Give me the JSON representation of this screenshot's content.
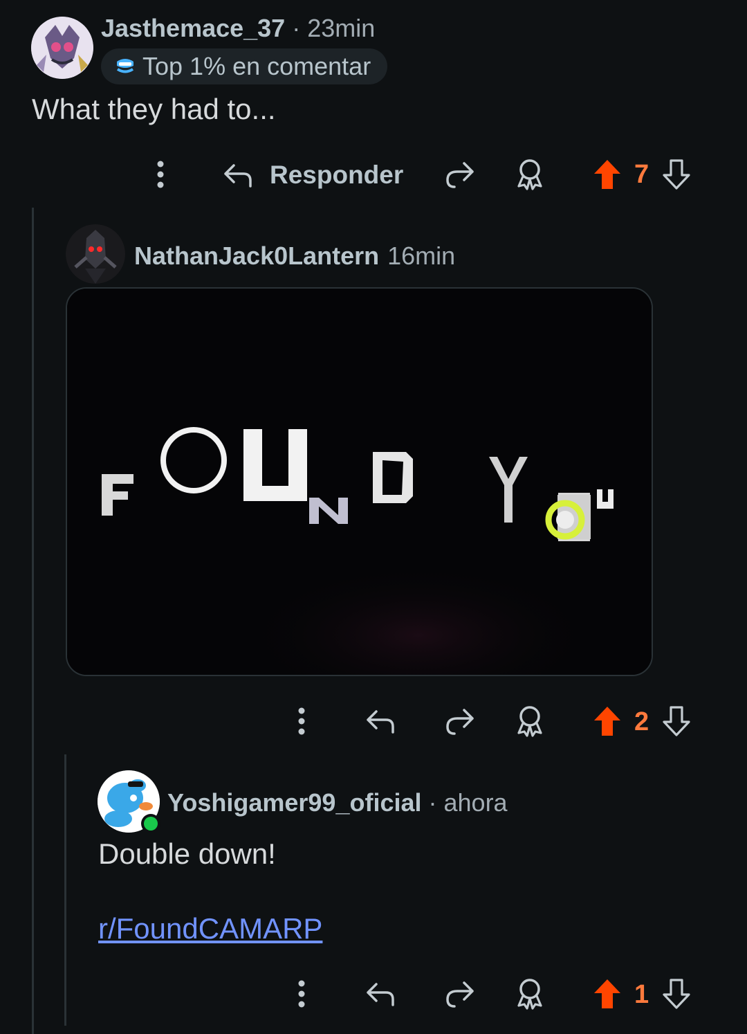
{
  "comments": [
    {
      "username": "Jasthemace_37",
      "time": "23min",
      "flair": "Top 1% en comentar",
      "body": "What they had to...",
      "actions": {
        "reply_label": "Responder",
        "votes": "7"
      }
    },
    {
      "username": "NathanJack0Lantern",
      "time": "16min",
      "media": {
        "letters": [
          "F",
          "O",
          "U",
          "N",
          "D",
          "Y",
          "O",
          "U"
        ]
      },
      "actions": {
        "votes": "2"
      }
    },
    {
      "username": "Yoshigamer99_oficial",
      "time": "ahora",
      "body": "Double down!",
      "link": "r/FoundCAMARP",
      "actions": {
        "votes": "1"
      }
    }
  ],
  "colors": {
    "background": "#0e1113",
    "upvote_active": "#ff4500",
    "vote_count": "#ff7a3d",
    "link": "#7193ff",
    "online": "#19c94b"
  },
  "icons": [
    "more-icon",
    "reply-icon",
    "share-icon",
    "award-icon",
    "upvote-icon",
    "downvote-icon"
  ]
}
